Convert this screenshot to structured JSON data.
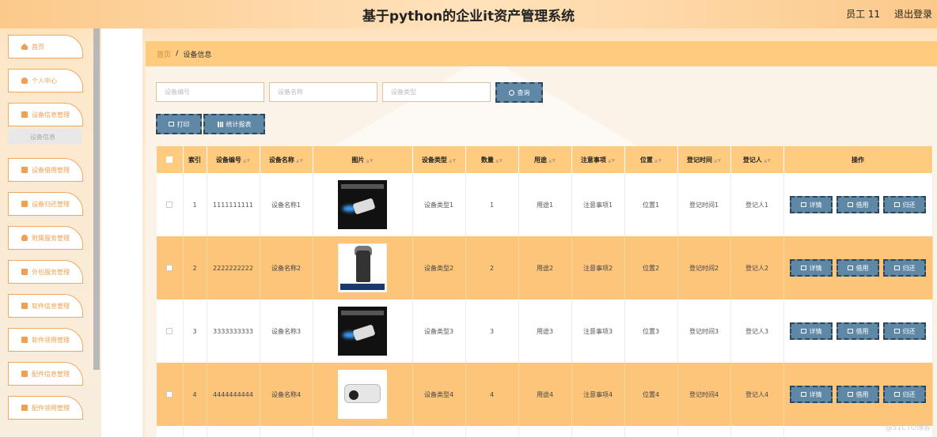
{
  "header": {
    "title": "基于python的企业it资产管理系统",
    "user": "员工 11",
    "logout": "退出登录"
  },
  "sidebar": {
    "items": [
      {
        "label": "首页",
        "icon": "home-icon"
      },
      {
        "label": "个人中心",
        "icon": "user-icon"
      },
      {
        "label": "设备信息管理",
        "icon": "grid-icon"
      },
      {
        "label": "设备借用管理",
        "icon": "grid-icon"
      },
      {
        "label": "设备归还管理",
        "icon": "grid-icon"
      },
      {
        "label": "附属服务管理",
        "icon": "person-icon"
      },
      {
        "label": "外包服务管理",
        "icon": "grid-icon"
      },
      {
        "label": "软件信息管理",
        "icon": "grid-icon"
      },
      {
        "label": "软件领用管理",
        "icon": "grid-icon"
      },
      {
        "label": "配件信息管理",
        "icon": "grid-icon"
      },
      {
        "label": "配件领用管理",
        "icon": "grid-icon"
      }
    ],
    "sub_item": "设备信息"
  },
  "breadcrumb": {
    "home": "首页",
    "current": "设备信息"
  },
  "search": {
    "code_placeholder": "设备编号",
    "name_placeholder": "设备名称",
    "type_placeholder": "设备类型",
    "query_label": "查询"
  },
  "toolbar": {
    "print_label": "打印",
    "report_label": "统计报表"
  },
  "table": {
    "headers": [
      "索引",
      "设备编号",
      "设备名称",
      "图片",
      "设备类型",
      "数量",
      "用途",
      "注意事项",
      "位置",
      "登记时间",
      "登记人",
      "操作"
    ],
    "rows": [
      {
        "index": "1",
        "code": "1111111111",
        "name": "设备名称1",
        "type": "设备类型1",
        "qty": "1",
        "use": "用途1",
        "note": "注意事项1",
        "loc": "位置1",
        "time": "登记时间1",
        "person": "登记人1"
      },
      {
        "index": "2",
        "code": "2222222222",
        "name": "设备名称2",
        "type": "设备类型2",
        "qty": "2",
        "use": "用途2",
        "note": "注意事项2",
        "loc": "位置2",
        "time": "登记时间2",
        "person": "登记人2"
      },
      {
        "index": "3",
        "code": "3333333333",
        "name": "设备名称3",
        "type": "设备类型3",
        "qty": "3",
        "use": "用途3",
        "note": "注意事项3",
        "loc": "位置3",
        "time": "登记时间3",
        "person": "登记人3"
      },
      {
        "index": "4",
        "code": "4444444444",
        "name": "设备名称4",
        "type": "设备类型4",
        "qty": "4",
        "use": "用途4",
        "note": "注意事项4",
        "loc": "位置4",
        "time": "登记时间4",
        "person": "登记人4"
      }
    ],
    "actions": {
      "detail": "详情",
      "borrow": "借用",
      "return": "归还"
    }
  },
  "watermark": "@51CTO博客",
  "colors": {
    "accent": "#fecb7f",
    "button": "#5f87a6",
    "sidebar_text": "#f0a050"
  }
}
